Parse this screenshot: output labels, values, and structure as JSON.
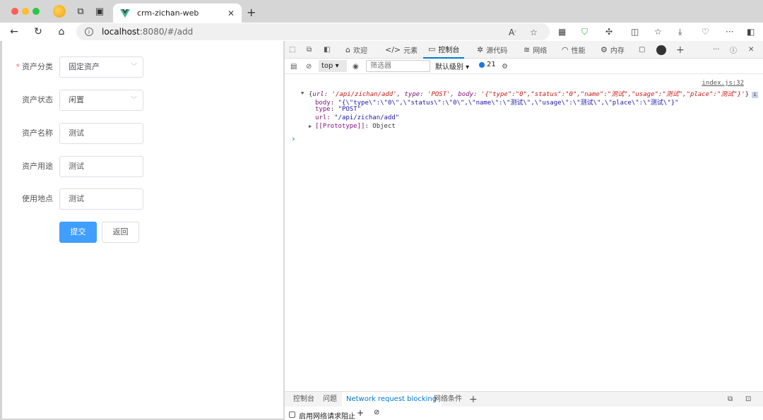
{
  "browser": {
    "tab_title": "crm-zichan-web",
    "url_host": "localhost",
    "url_path": ":8080/#/add"
  },
  "form": {
    "fields": [
      {
        "label": "资产分类",
        "value": "固定资产",
        "required": true,
        "type": "select"
      },
      {
        "label": "资产状态",
        "value": "闲置",
        "required": false,
        "type": "select"
      },
      {
        "label": "资产名称",
        "value": "测试",
        "required": false,
        "type": "input"
      },
      {
        "label": "资产用途",
        "value": "测试",
        "required": false,
        "type": "input"
      },
      {
        "label": "使用地点",
        "value": "测试",
        "required": false,
        "type": "input"
      }
    ],
    "submit_label": "提交",
    "back_label": "返回"
  },
  "devtools": {
    "tabs": [
      {
        "label": "欢迎",
        "icon": "home-icon"
      },
      {
        "label": "元素",
        "icon": "code-icon"
      },
      {
        "label": "控制台",
        "icon": "console-icon"
      },
      {
        "label": "源代码",
        "icon": "bug-icon"
      },
      {
        "label": "网络",
        "icon": "wifi-icon"
      },
      {
        "label": "性能",
        "icon": "gauge-icon"
      },
      {
        "label": "内存",
        "icon": "gear-icon"
      }
    ],
    "context": "top",
    "filter_placeholder": "筛选器",
    "levels": "默认级别",
    "issues_count": "21",
    "console": {
      "source": "index.js:32",
      "summary_key1": "url",
      "summary_val1": "'/api/zichan/add'",
      "summary_key2": "type",
      "summary_val2": "'POST'",
      "summary_key3": "body",
      "summary_val3": "'{\"type\":\"0\",\"status\":\"0\",\"name\":\"测试\",\"usage\":\"测试\",\"place\":\"测试\"}'",
      "body_key": "body",
      "body_val": "\"{\\\"type\\\":\\\"0\\\",\\\"status\\\":\\\"0\\\",\\\"name\\\":\\\"测试\\\",\\\"usage\\\":\\\"测试\\\",\\\"place\\\":\\\"测试\\\"}\"",
      "type_key": "type",
      "type_val": "\"POST\"",
      "url_key": "url",
      "url_val": "\"/api/zichan/add\"",
      "proto_key": "[[Prototype]]",
      "proto_val": "Object"
    },
    "drawer_tabs": [
      "控制台",
      "问题",
      "Network request blocking",
      "网络条件"
    ],
    "drawer_checkbox_label": "启用网络请求阻止"
  }
}
